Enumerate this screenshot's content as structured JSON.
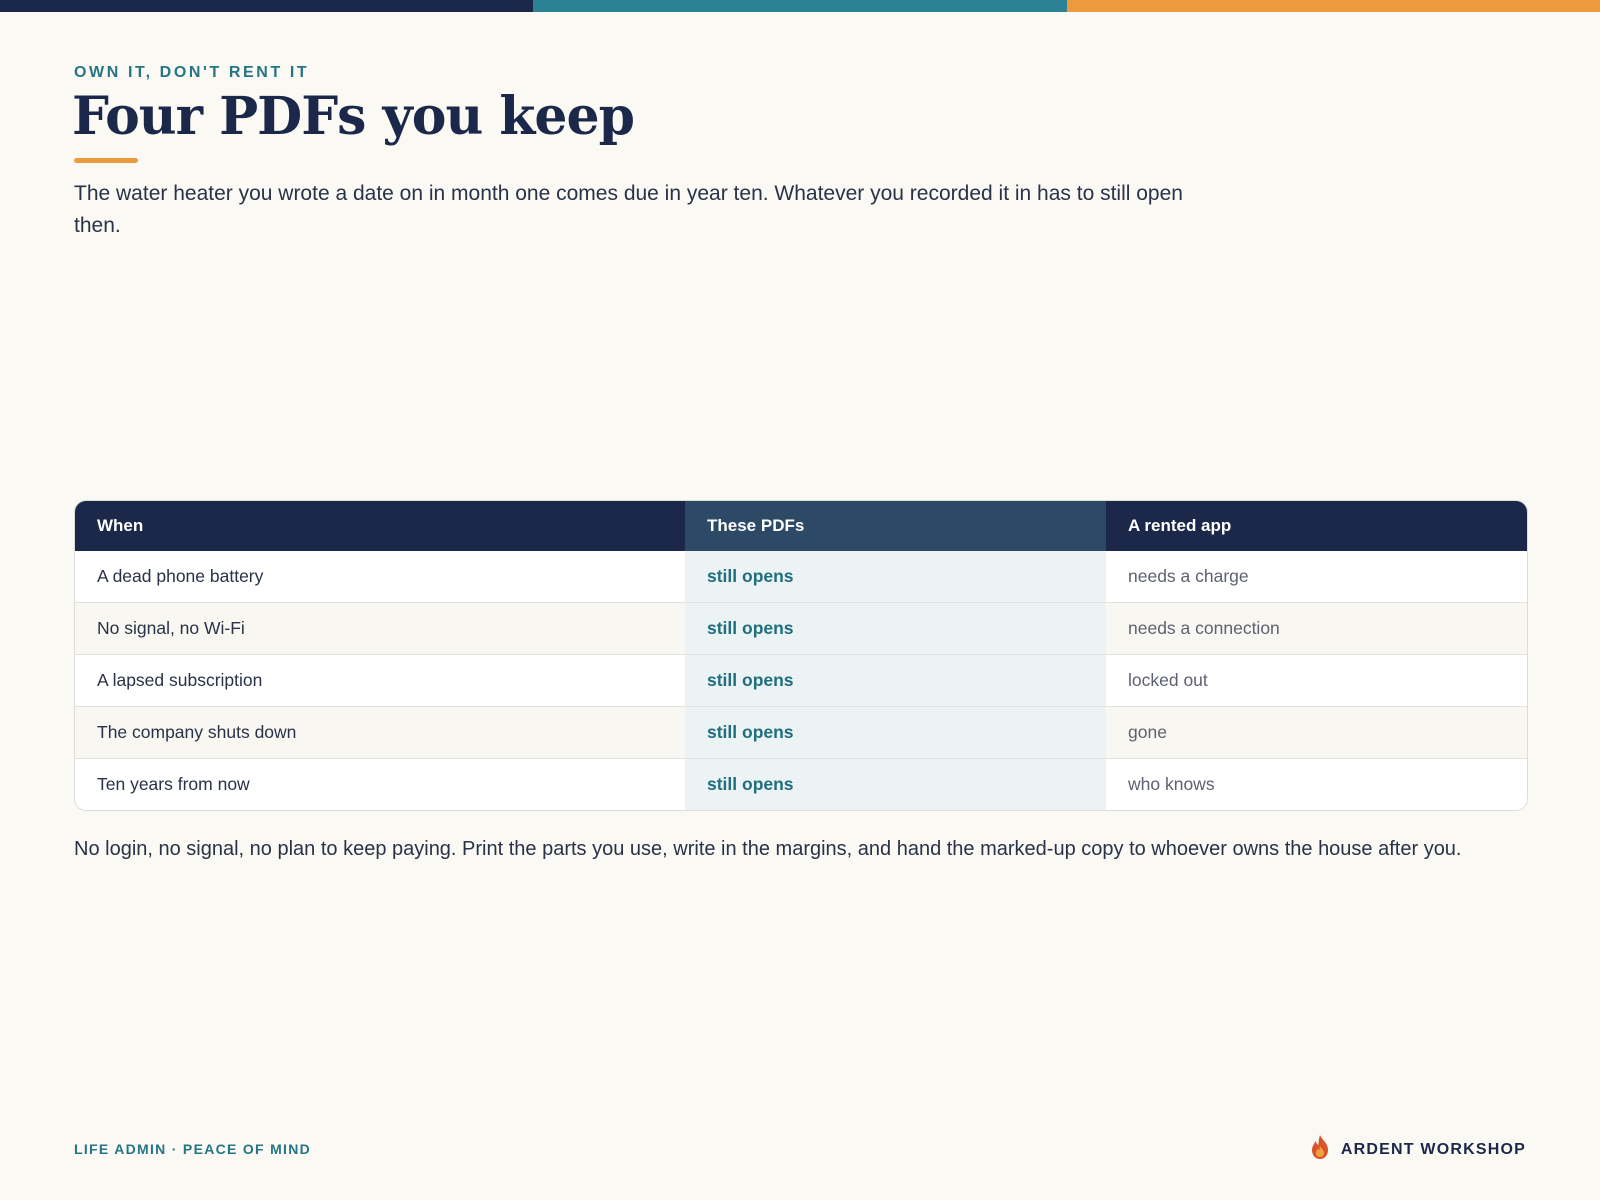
{
  "colors": {
    "navy": "#1b2849",
    "teal": "#2b8294",
    "orange": "#ec9a3e"
  },
  "eyebrow": "OWN IT, DON'T RENT IT",
  "title": "Four PDFs you keep",
  "lede": "The water heater you wrote a date on in month one comes due in year ten. Whatever you recorded it in has to still open then.",
  "table": {
    "headers": [
      "When",
      "These PDFs",
      "A rented app"
    ],
    "rows": [
      [
        "A dead phone battery",
        "still opens",
        "needs a charge"
      ],
      [
        "No signal, no Wi-Fi",
        "still opens",
        "needs a connection"
      ],
      [
        "A lapsed subscription",
        "still opens",
        "locked out"
      ],
      [
        "The company shuts down",
        "still opens",
        "gone"
      ],
      [
        "Ten years from now",
        "still opens",
        "who knows"
      ]
    ]
  },
  "note": "No login, no signal, no plan to keep paying. Print the parts you use, write in the margins, and hand the marked-up copy to whoever owns the house after you.",
  "footer": {
    "tagline": "LIFE ADMIN · PEACE OF MIND",
    "brand_icon": "flame-icon",
    "brand_name": "ARDENT WORKSHOP"
  }
}
